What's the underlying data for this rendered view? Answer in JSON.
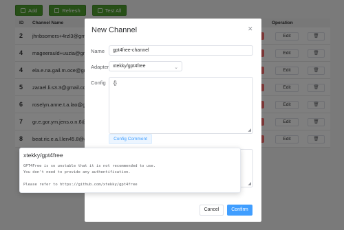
{
  "toolbar": {
    "add_label": "Add",
    "refresh_label": "Refresh",
    "test_all_label": "Test All"
  },
  "table": {
    "headers": {
      "id": "ID",
      "name": "Channel Name",
      "operation": "Operation"
    },
    "rows": [
      {
        "id": "2",
        "name": "jhnbsomers+4rzl3@gmail.com",
        "edit": "Edit",
        "delete": "🗑"
      },
      {
        "id": "4",
        "name": "mageerauld+uuzia@gmail.com",
        "edit": "Edit",
        "delete": "🗑"
      },
      {
        "id": "4",
        "name": "ela.e.na.gail.m.oce@gmail.com",
        "edit": "Edit",
        "delete": "🗑"
      },
      {
        "id": "5",
        "name": "zarael.li.s3.3@gmail.com",
        "edit": "Edit",
        "delete": "🗑"
      },
      {
        "id": "6",
        "name": "roselyn.anne.t.a.lao@gmail.com",
        "edit": "Edit",
        "delete": "🗑"
      },
      {
        "id": "7",
        "name": "gr.e.gor.ym.jens.o.n.6@gmail.com",
        "edit": "Edit",
        "delete": "🗑"
      },
      {
        "id": "8",
        "name": "beat.ric.e.a.l.len45.8@gmail.com",
        "edit": "Edit",
        "delete": "🗑"
      }
    ]
  },
  "dialog": {
    "title": "New Channel",
    "close_icon": "close-icon",
    "name_label": "Name",
    "name_value": "gpt4free-channel",
    "adapter_label": "Adapter",
    "adapter_value": "xtekky/gpt4free",
    "config_label": "Config",
    "config_value": "{}",
    "config_comment_label": "Config Comment",
    "cancel_label": "Cancel",
    "confirm_label": "Confirm"
  },
  "popover": {
    "title": "xtekky/gpt4free",
    "line1": "GPT4Free is so unstable that it is not recommended to use.",
    "line2": "You don't need to provide any authentification.",
    "line3": "Please refer to https://github.com/xtekky/gpt4free"
  },
  "colors": {
    "primary": "#409eff",
    "success": "#4f9f2f",
    "danger": "#f56c6c"
  }
}
